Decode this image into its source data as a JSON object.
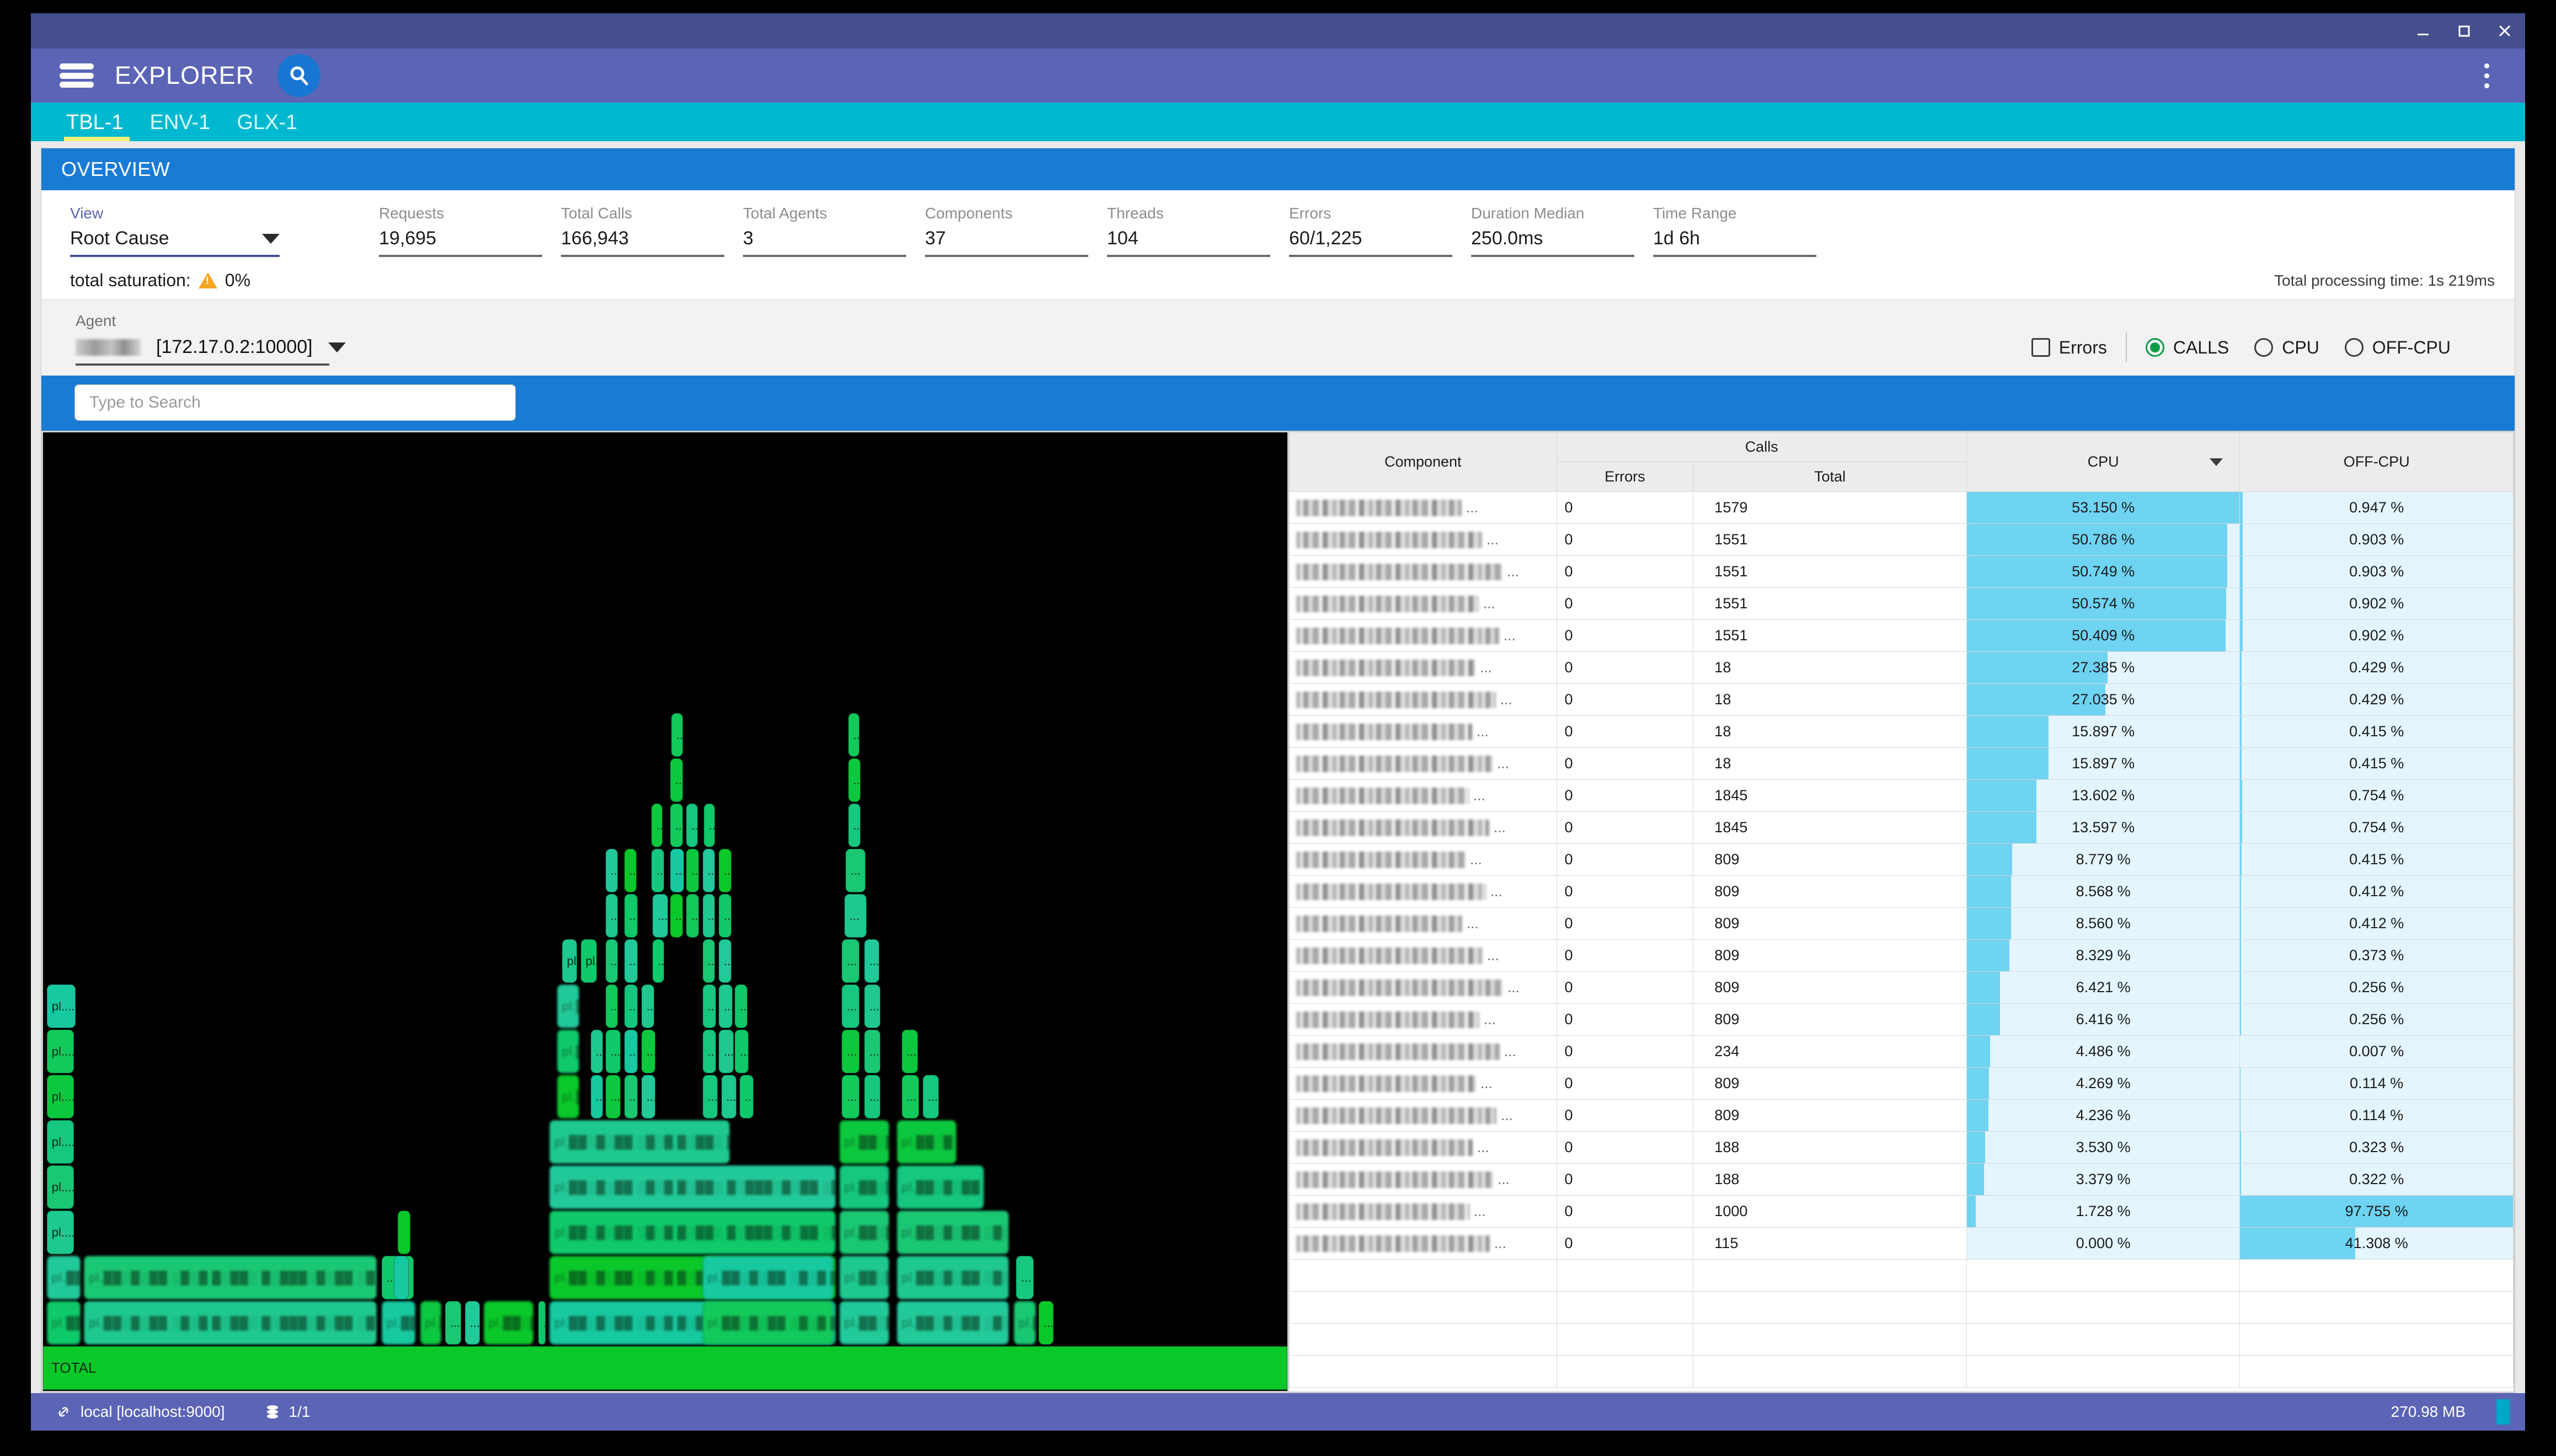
{
  "window": {
    "minimize_icon": "minimize-icon",
    "maximize_icon": "maximize-icon",
    "close_icon": "close-icon"
  },
  "appbar": {
    "menu_icon": "hamburger-menu-icon",
    "title": "EXPLORER",
    "search_icon": "search-icon",
    "overflow_icon": "kebab-menu-icon"
  },
  "tabs": [
    {
      "label": "TBL-1",
      "active": true
    },
    {
      "label": "ENV-1",
      "active": false
    },
    {
      "label": "GLX-1",
      "active": false
    }
  ],
  "panel": {
    "title": "OVERVIEW"
  },
  "view": {
    "label": "View",
    "selected": "Root Cause"
  },
  "stats": [
    {
      "label": "Requests",
      "value": "19,695"
    },
    {
      "label": "Total Calls",
      "value": "166,943"
    },
    {
      "label": "Total Agents",
      "value": "3"
    },
    {
      "label": "Components",
      "value": "37"
    },
    {
      "label": "Threads",
      "value": "104"
    },
    {
      "label": "Errors",
      "value": "60/1,225"
    },
    {
      "label": "Duration Median",
      "value": "250.0ms"
    },
    {
      "label": "Time Range",
      "value": "1d 6h"
    }
  ],
  "saturation": {
    "label": "total saturation:",
    "warning_icon": "warning-triangle-icon",
    "value": "0%",
    "processing_time": "Total processing time: 1s 219ms"
  },
  "agent": {
    "label": "Agent",
    "name_redacted": true,
    "address": "[172.17.0.2:10000]"
  },
  "toggles": {
    "errors_checkbox": {
      "label": "Errors",
      "checked": false
    },
    "metric_radios": [
      {
        "label": "CALLS",
        "selected": true
      },
      {
        "label": "CPU",
        "selected": false
      },
      {
        "label": "OFF-CPU",
        "selected": false
      }
    ]
  },
  "search": {
    "placeholder": "Type to Search",
    "value": ""
  },
  "flamegraph": {
    "root_label": "TOTAL",
    "truncated_label": "pl....",
    "short_label": "..."
  },
  "table": {
    "headers": {
      "component": "Component",
      "calls_group": "Calls",
      "errors": "Errors",
      "total": "Total",
      "cpu": "CPU",
      "offcpu": "OFF-CPU",
      "sorted_column": "CPU",
      "sort_direction": "desc"
    },
    "rows": [
      {
        "component": "",
        "errors": "0",
        "total": "1579",
        "cpu": "53.150 %",
        "offcpu": "0.947 %"
      },
      {
        "component": "",
        "errors": "0",
        "total": "1551",
        "cpu": "50.786 %",
        "offcpu": "0.903 %"
      },
      {
        "component": "",
        "errors": "0",
        "total": "1551",
        "cpu": "50.749 %",
        "offcpu": "0.903 %"
      },
      {
        "component": "",
        "errors": "0",
        "total": "1551",
        "cpu": "50.574 %",
        "offcpu": "0.902 %"
      },
      {
        "component": "",
        "errors": "0",
        "total": "1551",
        "cpu": "50.409 %",
        "offcpu": "0.902 %"
      },
      {
        "component": "",
        "errors": "0",
        "total": "18",
        "cpu": "27.385 %",
        "offcpu": "0.429 %"
      },
      {
        "component": "",
        "errors": "0",
        "total": "18",
        "cpu": "27.035 %",
        "offcpu": "0.429 %"
      },
      {
        "component": "",
        "errors": "0",
        "total": "18",
        "cpu": "15.897 %",
        "offcpu": "0.415 %"
      },
      {
        "component": "",
        "errors": "0",
        "total": "18",
        "cpu": "15.897 %",
        "offcpu": "0.415 %"
      },
      {
        "component": "",
        "errors": "0",
        "total": "1845",
        "cpu": "13.602 %",
        "offcpu": "0.754 %"
      },
      {
        "component": "",
        "errors": "0",
        "total": "1845",
        "cpu": "13.597 %",
        "offcpu": "0.754 %"
      },
      {
        "component": "",
        "errors": "0",
        "total": "809",
        "cpu": "8.779 %",
        "offcpu": "0.415 %"
      },
      {
        "component": "",
        "errors": "0",
        "total": "809",
        "cpu": "8.568 %",
        "offcpu": "0.412 %"
      },
      {
        "component": "",
        "errors": "0",
        "total": "809",
        "cpu": "8.560 %",
        "offcpu": "0.412 %"
      },
      {
        "component": "",
        "errors": "0",
        "total": "809",
        "cpu": "8.329 %",
        "offcpu": "0.373 %"
      },
      {
        "component": "",
        "errors": "0",
        "total": "809",
        "cpu": "6.421 %",
        "offcpu": "0.256 %"
      },
      {
        "component": "",
        "errors": "0",
        "total": "809",
        "cpu": "6.416 %",
        "offcpu": "0.256 %"
      },
      {
        "component": "",
        "errors": "0",
        "total": "234",
        "cpu": "4.486 %",
        "offcpu": "0.007 %"
      },
      {
        "component": "",
        "errors": "0",
        "total": "809",
        "cpu": "4.269 %",
        "offcpu": "0.114 %"
      },
      {
        "component": "",
        "errors": "0",
        "total": "809",
        "cpu": "4.236 %",
        "offcpu": "0.114 %"
      },
      {
        "component": "",
        "errors": "0",
        "total": "188",
        "cpu": "3.530 %",
        "offcpu": "0.323 %"
      },
      {
        "component": "",
        "errors": "0",
        "total": "188",
        "cpu": "3.379 %",
        "offcpu": "0.322 %"
      },
      {
        "component": "",
        "errors": "0",
        "total": "1000",
        "cpu": "1.728 %",
        "offcpu": "97.755 %"
      },
      {
        "component": "",
        "errors": "0",
        "total": "115",
        "cpu": "0.000 %",
        "offcpu": "41.308 %"
      }
    ]
  },
  "statusbar": {
    "link_icon": "link-icon",
    "connection": "local [localhost:9000]",
    "database_icon": "database-icon",
    "db_count": "1/1",
    "memory": "270.98 MB"
  },
  "colors": {
    "titlebar": "#464f8e",
    "appbar": "#5b64b5",
    "tabstrip": "#00b9d1",
    "panel_header": "#1a7bd4",
    "accent_bar": "#6fd3f2",
    "cell_bg": "#e4f5fd",
    "warning": "#f5a623",
    "radio_on": "#0a9c4a",
    "flame": "#0ac82a"
  }
}
